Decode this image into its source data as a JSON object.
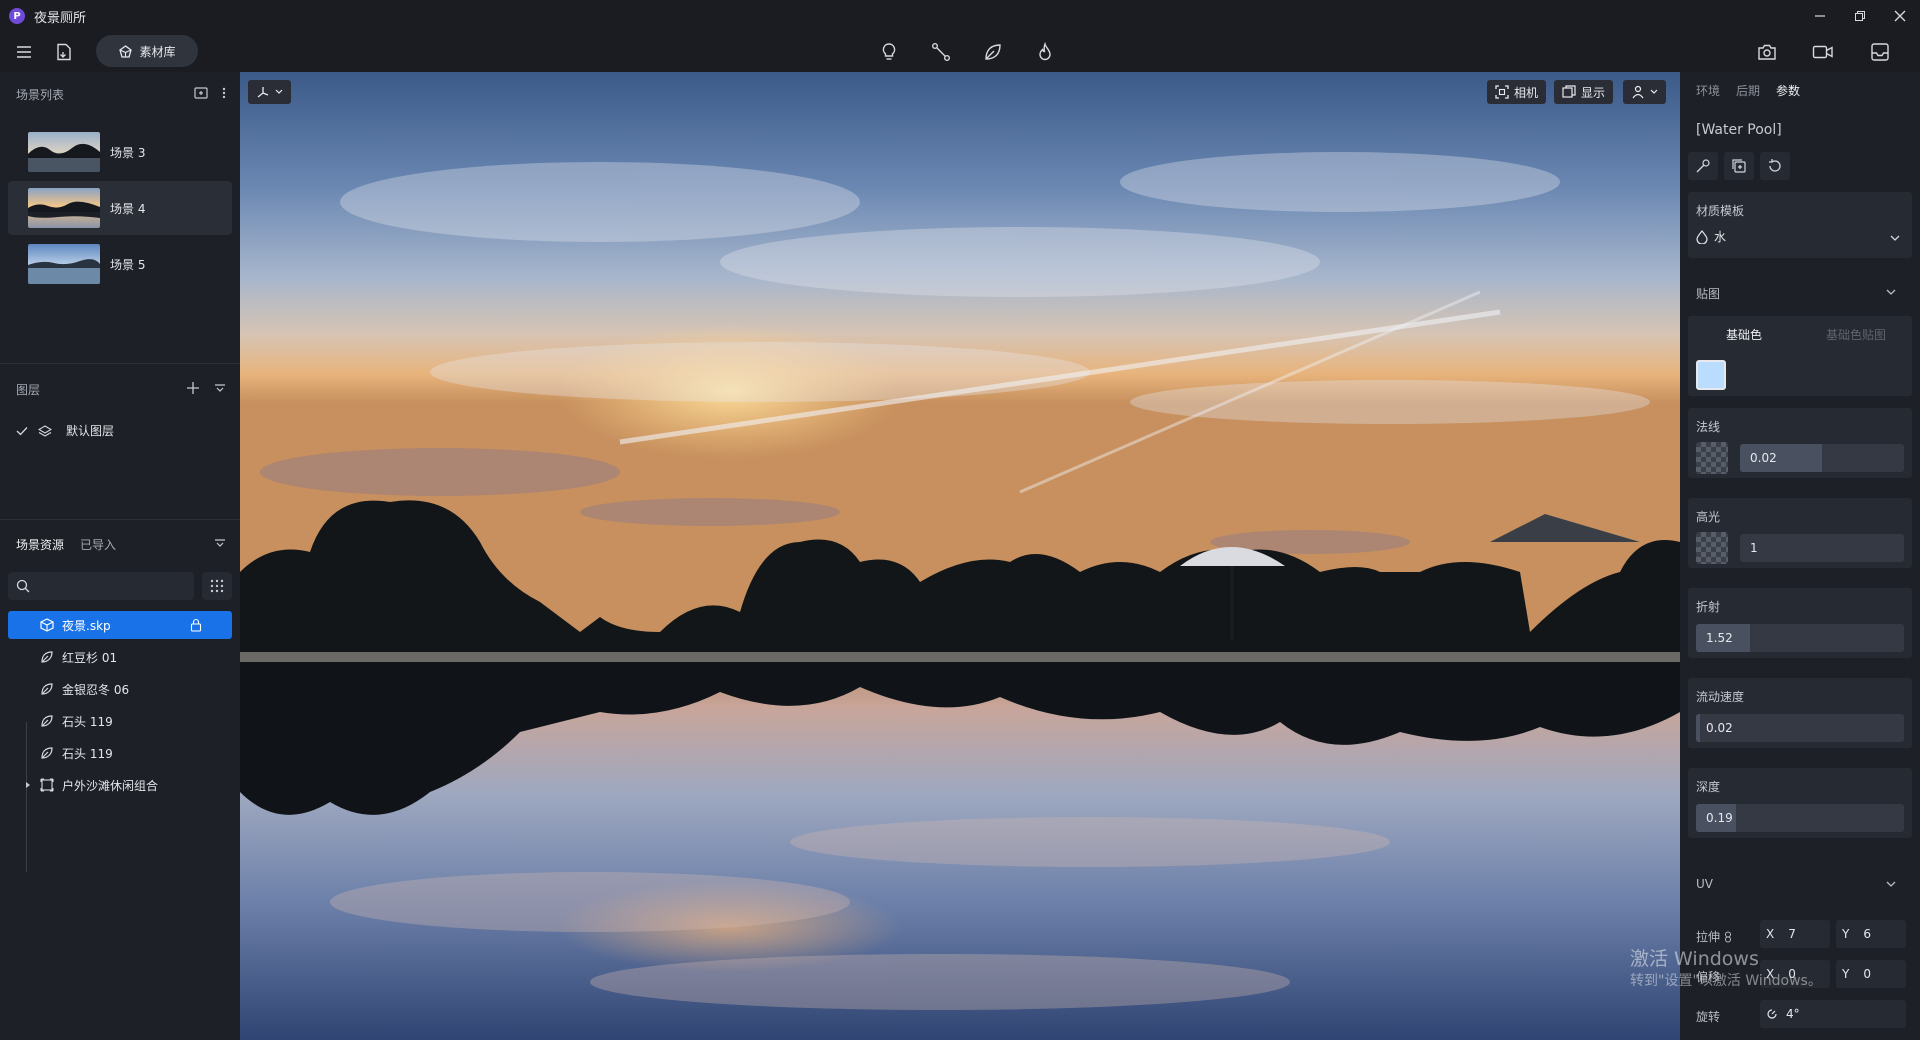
{
  "app": {
    "title": "夜景厕所",
    "logo_letter": "P"
  },
  "toolbar": {
    "material_label": "素材库"
  },
  "left": {
    "scene_list_title": "场景列表",
    "scenes": [
      {
        "label": "场景 3"
      },
      {
        "label": "场景 4"
      },
      {
        "label": "场景 5"
      }
    ],
    "layers_title": "图层",
    "default_layer": "默认图层",
    "assets_tabs": {
      "active": "场景资源",
      "other": "已导入"
    },
    "tree": [
      {
        "label": "夜景.skp"
      },
      {
        "label": "红豆杉 01"
      },
      {
        "label": "金银忍冬 06"
      },
      {
        "label": "石头 119"
      },
      {
        "label": "石头 119"
      },
      {
        "label": "户外沙滩休闲组合"
      }
    ]
  },
  "viewport": {
    "camera_label": "相机",
    "display_label": "显示"
  },
  "right": {
    "tabs": [
      "环境",
      "后期",
      "参数"
    ],
    "material_name": "[Water Pool]",
    "template": {
      "label": "材质模板",
      "value": "水"
    },
    "texture": {
      "title": "贴图",
      "subtabs": [
        "基础色",
        "基础色贴图"
      ],
      "base_color": "#b9dcff"
    },
    "normal": {
      "label": "法线",
      "value": "0.02",
      "fill": 0.5
    },
    "specular": {
      "label": "高光",
      "value": "1",
      "fill": 0
    },
    "refraction": {
      "label": "折射",
      "value": "1.52",
      "fill": 0.26
    },
    "flow_speed": {
      "label": "流动速度",
      "value": "0.02",
      "fill": 0.02
    },
    "depth": {
      "label": "深度",
      "value": "0.19",
      "fill": 0.19
    },
    "uv": {
      "title": "UV",
      "stretch_label": "拉伸",
      "offset_label": "偏移",
      "rotate_label": "旋转",
      "stretch_x": "7",
      "stretch_y": "6",
      "offset_x": "0",
      "offset_y": "0",
      "rotate": "4°",
      "x_label": "X",
      "y_label": "Y"
    }
  },
  "watermark": {
    "line1": "激活 Windows",
    "line2": "转到\"设置\"以激活 Windows。"
  }
}
